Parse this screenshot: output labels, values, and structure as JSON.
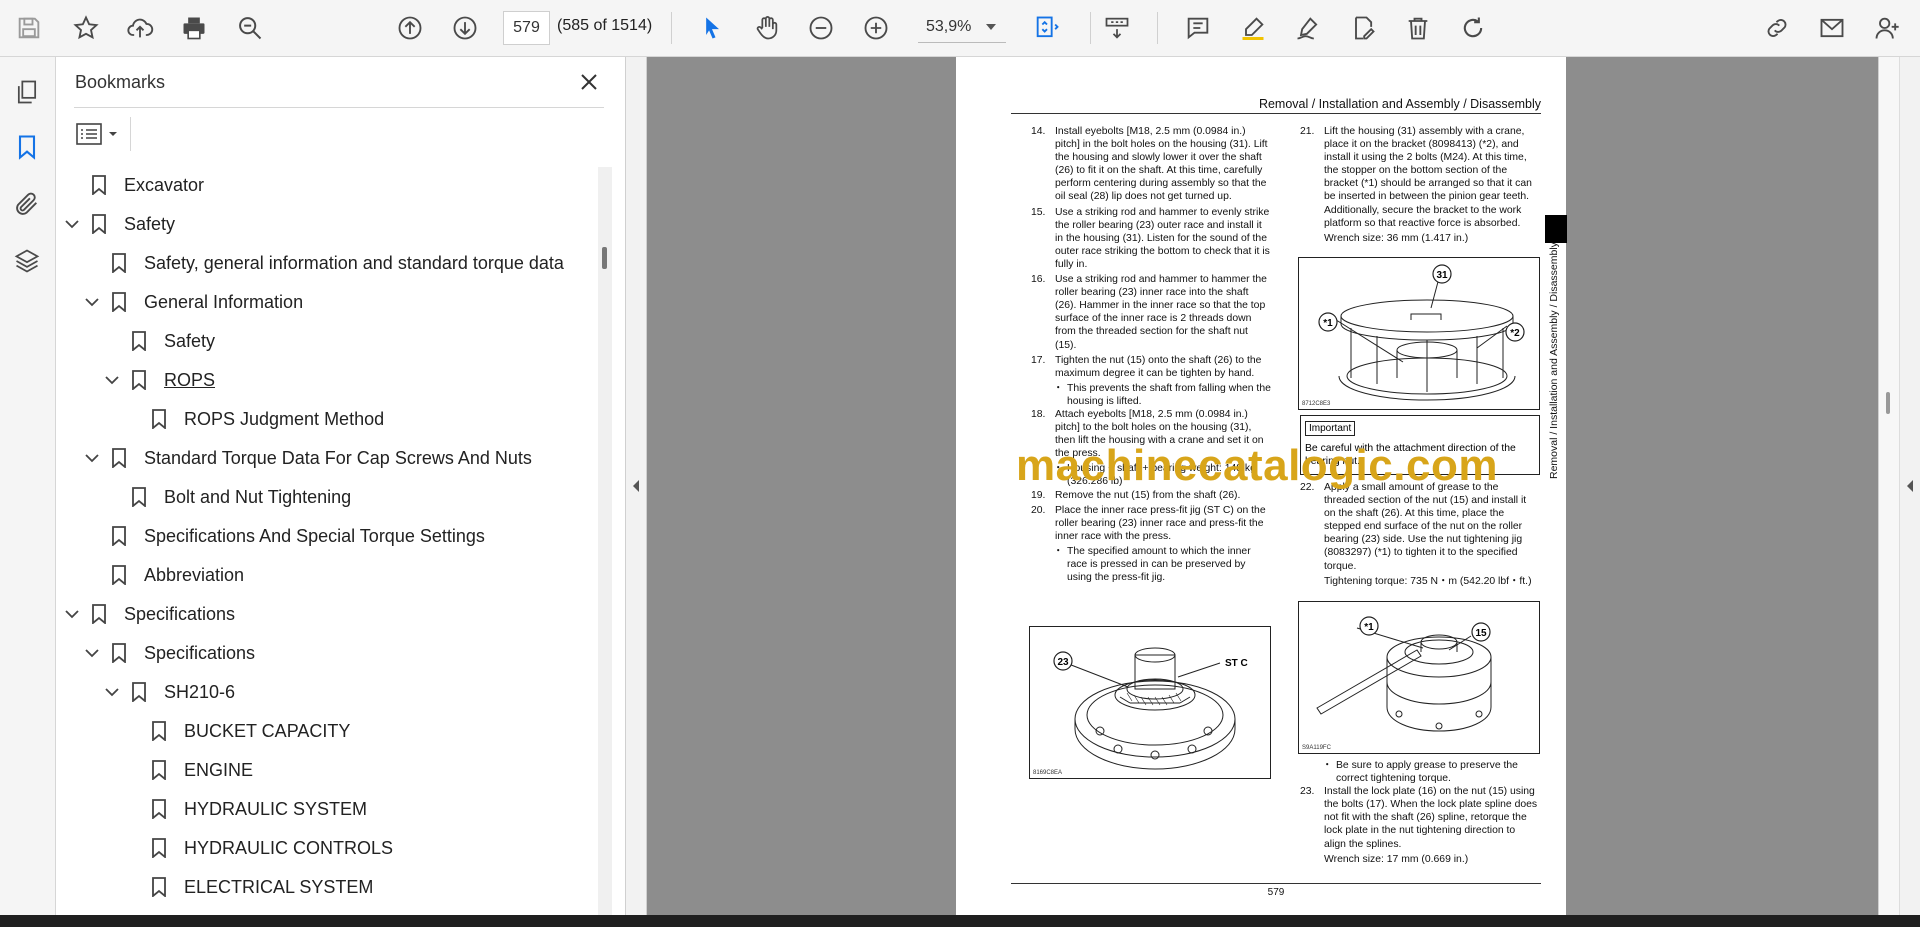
{
  "toolbar": {
    "current_page": "579",
    "page_count": "(585 of 1514)",
    "zoom": "53,9%"
  },
  "bookmarks": {
    "title": "Bookmarks",
    "items": [
      {
        "label": "Excavator",
        "level": 0,
        "chevron": "none"
      },
      {
        "label": "Safety",
        "level": 0,
        "chevron": "down"
      },
      {
        "label": "Safety, general information and standard torque data",
        "level": 1,
        "chevron": "none"
      },
      {
        "label": "General Information",
        "level": 1,
        "chevron": "down"
      },
      {
        "label": "Safety",
        "level": 2,
        "chevron": "none"
      },
      {
        "label": "ROPS",
        "level": 2,
        "chevron": "down"
      },
      {
        "label": "ROPS Judgment Method",
        "level": 3,
        "chevron": "none"
      },
      {
        "label": "Standard Torque Data For Cap Screws And Nuts",
        "level": 1,
        "chevron": "down"
      },
      {
        "label": "Bolt and Nut Tightening",
        "level": 2,
        "chevron": "none"
      },
      {
        "label": "Specifications And Special Torque Settings",
        "level": 1,
        "chevron": "none"
      },
      {
        "label": "Abbreviation",
        "level": 1,
        "chevron": "none"
      },
      {
        "label": "Specifications",
        "level": 0,
        "chevron": "down"
      },
      {
        "label": "Specifications",
        "level": 1,
        "chevron": "down"
      },
      {
        "label": "SH210-6",
        "level": 2,
        "chevron": "down"
      },
      {
        "label": "BUCKET CAPACITY",
        "level": 3,
        "chevron": "none"
      },
      {
        "label": "ENGINE",
        "level": 3,
        "chevron": "none"
      },
      {
        "label": "HYDRAULIC SYSTEM",
        "level": 3,
        "chevron": "none"
      },
      {
        "label": "HYDRAULIC CONTROLS",
        "level": 3,
        "chevron": "none"
      },
      {
        "label": "ELECTRICAL SYSTEM",
        "level": 3,
        "chevron": "none"
      }
    ]
  },
  "document": {
    "header": "Removal / Installation and Assembly / Disassembly",
    "side_label": "Removal / Installation and Assembly / Disassembly",
    "page_number": "579",
    "watermark": "machinecatalogic.com",
    "left_steps": [
      {
        "n": "14.",
        "text": "Install eyebolts [M18, 2.5 mm (0.0984 in.) pitch] in the bolt holes on the housing (31). Lift the housing and slowly lower it over the shaft (26) to fit it on the shaft. At this time, carefully perform centering during assembly so that the oil seal (28) lip does not get turned up."
      },
      {
        "n": "15.",
        "text": "Use a striking rod and hammer to evenly strike the roller bearing (23) outer race and install it in the housing (31). Listen for the sound of the outer race striking the bottom to check that it is fully in."
      },
      {
        "n": "16.",
        "text": "Use a striking rod and hammer to hammer the roller bearing (23) inner race into the shaft (26). Hammer in the inner race so that the top surface of the inner race is 2 threads down from the threaded section for the shaft nut (15)."
      },
      {
        "n": "17.",
        "text": "Tighten the nut (15) onto the shaft (26) to the maximum degree it can be tighten by hand."
      },
      {
        "bullet": "This prevents the shaft from falling when the housing is lifted."
      },
      {
        "n": "18.",
        "text": "Attach eyebolts [M18, 2.5 mm (0.0984 in.) pitch] to the bolt holes on the housing (31), then lift the housing with a crane and set it on the press."
      },
      {
        "bullet": "Housing + shaft + bearing weight: 148 kg (326.286 lb)"
      },
      {
        "n": "19.",
        "text": "Remove the nut (15) from the shaft (26)."
      },
      {
        "n": "20.",
        "text": "Place the inner race press-fit jig (ST C) on the roller bearing (23) inner race and press-fit the inner race with the press."
      },
      {
        "bullet": "The specified amount to which the inner race is pressed in can be preserved by using the press-fit jig."
      }
    ],
    "right_steps_a": [
      {
        "n": "21.",
        "text": "Lift the housing (31) assembly with a crane, place it on the bracket (8098413) (*2), and install it using the 2 bolts (M24). At this time, the stopper on the bottom section of the bracket (*1) should be arranged so that it can be inserted in between the pinion gear teeth. Additionally, secure the bracket to the work platform so that reactive force is absorbed."
      },
      {
        "plain": "Wrench size: 36 mm (1.417 in.)"
      }
    ],
    "important_tag": "Important",
    "important_text": "Be careful with the attachment direction of the bearing nut.",
    "right_steps_b": [
      {
        "n": "22.",
        "text": "Apply a small amount of grease to the threaded section of the nut (15) and install it on the shaft (26). At this time, place the stepped end surface of the nut on the roller bearing (23) side. Use the nut tightening jig (8083297) (*1) to tighten it to the specified torque."
      },
      {
        "plain": "Tightening torque: 735 N・m (542.20 lbf・ft.)"
      }
    ],
    "right_steps_c": [
      {
        "bullet": "Be sure to apply grease to preserve the correct tightening torque."
      },
      {
        "n": "23.",
        "text": "Install the lock plate (16) on the nut (15) using the bolts (17). When the lock plate spline does not fit with the shaft (26) spline, retorque the lock plate in the nut tightening direction to align the splines."
      },
      {
        "plain": "Wrench size: 17 mm (0.669 in.)"
      }
    ],
    "fig1": {
      "code": "8169C8EA",
      "labels": [
        "23",
        "ST C"
      ]
    },
    "fig2": {
      "code": "8712C8E3",
      "labels": [
        "31",
        "*1",
        "*2"
      ]
    },
    "fig3": {
      "code": "S9A119FC",
      "labels": [
        "*1",
        "15"
      ]
    }
  },
  "colors": {
    "accent": "#1473e6",
    "watermark": "#d8a51a"
  }
}
